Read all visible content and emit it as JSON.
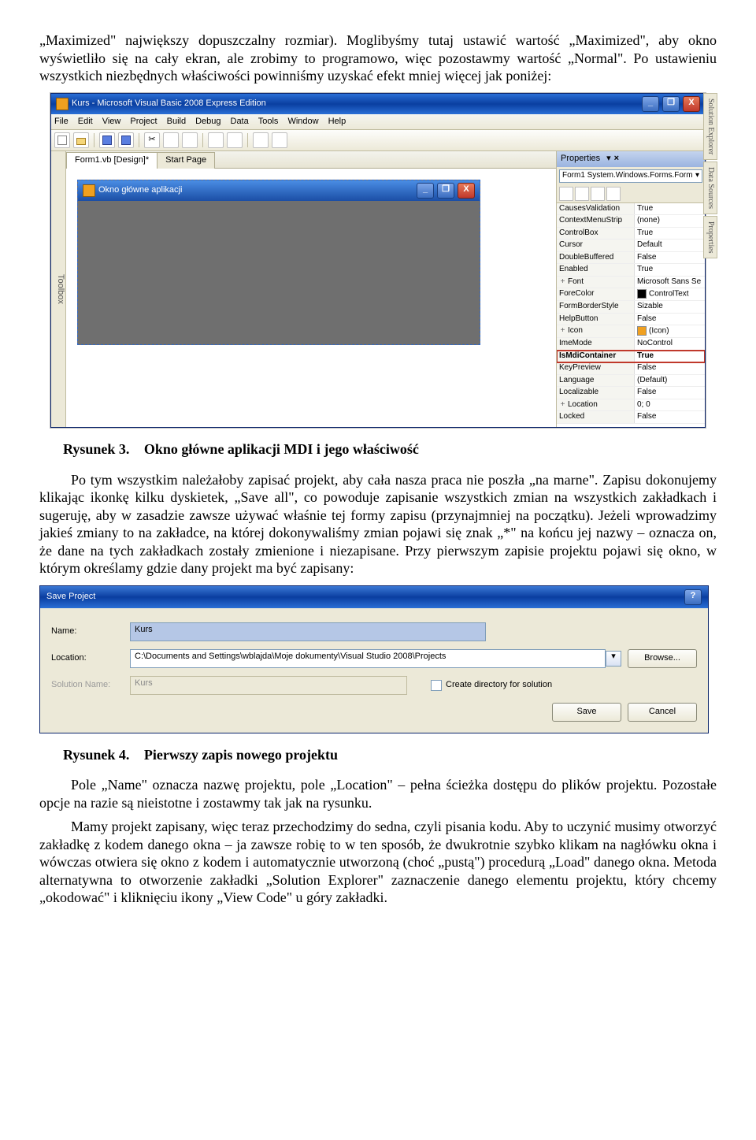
{
  "para1": "„Maximized\" największy dopuszczalny rozmiar). Moglibyśmy tutaj ustawić wartość „Maximized\", aby okno wyświetliło się na cały ekran, ale zrobimy to programowo, więc pozostawmy wartość „Normal\". Po ustawieniu wszystkich niezbędnych właściwości powinniśmy uzyskać efekt mniej więcej jak poniżej:",
  "ide": {
    "title": "Kurs - Microsoft Visual Basic 2008 Express Edition",
    "menu": [
      "File",
      "Edit",
      "View",
      "Project",
      "Build",
      "Debug",
      "Data",
      "Tools",
      "Window",
      "Help"
    ],
    "tabs": [
      "Form1.vb [Design]*",
      "Start Page"
    ],
    "mdi_title": "Okno główne aplikacji",
    "toolbox": "Toolbox",
    "prop_title": "Properties",
    "prop_object": "Form1 System.Windows.Forms.Form",
    "side_tabs": [
      "Solution Explorer",
      "Data Sources",
      "Properties"
    ],
    "props": [
      {
        "n": "CausesValidation",
        "v": "True"
      },
      {
        "n": "ContextMenuStrip",
        "v": "(none)"
      },
      {
        "n": "ControlBox",
        "v": "True"
      },
      {
        "n": "Cursor",
        "v": "Default"
      },
      {
        "n": "DoubleBuffered",
        "v": "False"
      },
      {
        "n": "Enabled",
        "v": "True"
      },
      {
        "n": "Font",
        "v": "Microsoft Sans Se",
        "exp": "+"
      },
      {
        "n": "ForeColor",
        "v": "ControlText",
        "swatch": "#000"
      },
      {
        "n": "FormBorderStyle",
        "v": "Sizable"
      },
      {
        "n": "HelpButton",
        "v": "False"
      },
      {
        "n": "Icon",
        "v": "(Icon)",
        "exp": "+",
        "swatch": "#f0a020"
      },
      {
        "n": "ImeMode",
        "v": "NoControl"
      },
      {
        "n": "IsMdiContainer",
        "v": "True",
        "hi": true
      },
      {
        "n": "KeyPreview",
        "v": "False"
      },
      {
        "n": "Language",
        "v": "(Default)"
      },
      {
        "n": "Localizable",
        "v": "False"
      },
      {
        "n": "Location",
        "v": "0; 0",
        "exp": "+"
      },
      {
        "n": "Locked",
        "v": "False"
      }
    ]
  },
  "caption3": {
    "label": "Rysunek 3.",
    "text": "Okno główne aplikacji MDI i jego właściwość"
  },
  "para2": "Po tym wszystkim należałoby zapisać projekt, aby cała nasza praca nie poszła „na marne\". Zapisu dokonujemy klikając ikonkę kilku dyskietek, „Save all\", co powoduje zapisanie wszystkich zmian na wszystkich zakładkach i sugeruję, aby w zasadzie zawsze używać właśnie tej formy zapisu (przynajmniej na początku). Jeżeli wprowadzimy jakieś zmiany to na zakładce, na której dokonywaliśmy zmian pojawi się znak „*\" na końcu jej nazwy – oznacza on, że dane na tych zakładkach zostały zmienione i niezapisane. Przy pierwszym zapisie projektu pojawi się okno, w którym określamy gdzie dany projekt ma być zapisany:",
  "dlg": {
    "title": "Save Project",
    "name_label": "Name:",
    "name_value": "Kurs",
    "loc_label": "Location:",
    "loc_value": "C:\\Documents and Settings\\wblajda\\Moje dokumenty\\Visual Studio 2008\\Projects",
    "browse": "Browse...",
    "sol_label": "Solution Name:",
    "sol_value": "Kurs",
    "chk_label": "Create directory for solution",
    "save": "Save",
    "cancel": "Cancel"
  },
  "caption4": {
    "label": "Rysunek 4.",
    "text": "Pierwszy zapis nowego projektu"
  },
  "para3": "Pole „Name\" oznacza nazwę projektu, pole „Location\" – pełna ścieżka dostępu do plików projektu. Pozostałe opcje na razie są nieistotne i zostawmy tak jak na rysunku.",
  "para4": "Mamy projekt zapisany, więc teraz przechodzimy do sedna, czyli pisania kodu. Aby to uczynić musimy otworzyć zakładkę z kodem danego okna – ja zawsze robię to w ten sposób, że dwukrotnie szybko klikam na nagłówku okna i wówczas otwiera się okno z kodem i automatycznie utworzoną (choć „pustą\") procedurą „Load\" danego okna. Metoda alternatywna to otworzenie zakładki „Solution Explorer\" zaznaczenie danego elementu projektu, który chcemy „okodować\" i kliknięciu ikony „View Code\" u góry zakładki."
}
